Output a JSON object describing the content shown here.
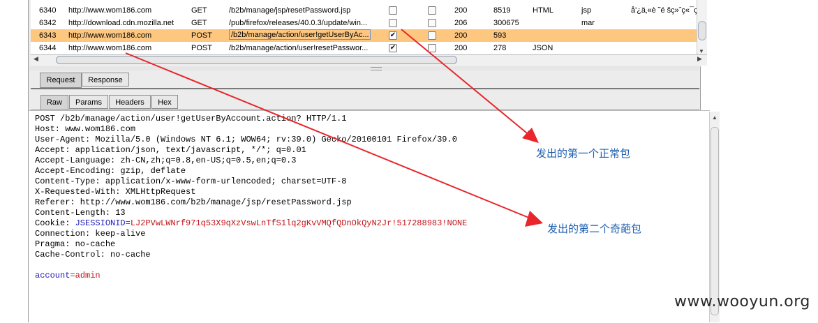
{
  "history": {
    "rows": [
      {
        "num": "6340",
        "host": "http://www.wom186.com",
        "method": "GET",
        "url": "/b2b/manage/jsp/resetPassword.jsp",
        "params": false,
        "edited": false,
        "status": "200",
        "length": "8519",
        "mime": "HTML",
        "ext": "jsp",
        "title": "å'¿ä‚«è ˜é šç»ˆç«¯ç©"
      },
      {
        "num": "6342",
        "host": "http://download.cdn.mozilla.net",
        "method": "GET",
        "url": "/pub/firefox/releases/40.0.3/update/win...",
        "params": false,
        "edited": false,
        "status": "206",
        "length": "300675",
        "mime": "",
        "ext": "mar",
        "title": ""
      },
      {
        "num": "6343",
        "host": "http://www.wom186.com",
        "method": "POST",
        "url": "/b2b/manage/action/user!getUserByAc...",
        "params": true,
        "edited": false,
        "status": "200",
        "length": "593",
        "mime": "",
        "ext": "",
        "title": ""
      },
      {
        "num": "6344",
        "host": "http://www.wom186.com",
        "method": "POST",
        "url": "/b2b/manage/action/user!resetPasswor...",
        "params": true,
        "edited": false,
        "status": "200",
        "length": "278",
        "mime": "JSON",
        "ext": "",
        "title": ""
      }
    ],
    "selected_index": 2
  },
  "tabs": {
    "outer": [
      "Request",
      "Response"
    ],
    "inner": [
      "Raw",
      "Params",
      "Headers",
      "Hex"
    ]
  },
  "request": {
    "lines": [
      "POST /b2b/manage/action/user!getUserByAccount.action? HTTP/1.1",
      "Host: www.wom186.com",
      "User-Agent: Mozilla/5.0 (Windows NT 6.1; WOW64; rv:39.0) Gecko/20100101 Firefox/39.0",
      "Accept: application/json, text/javascript, */*; q=0.01",
      "Accept-Language: zh-CN,zh;q=0.8,en-US;q=0.5,en;q=0.3",
      "Accept-Encoding: gzip, deflate",
      "Content-Type: application/x-www-form-urlencoded; charset=UTF-8",
      "X-Requested-With: XMLHttpRequest",
      "Referer: http://www.wom186.com/b2b/manage/jsp/resetPassword.jsp",
      "Content-Length: 13"
    ],
    "cookie_label": "Cookie: ",
    "cookie_name": "JSESSIONID",
    "cookie_value": "=LJ2PVwLWNrf971q53X9qXzVswLnTfS1lq2gKvVMQfQDnOkQyN2Jr!517288983!NONE",
    "lines_after": [
      "Connection: keep-alive",
      "Pragma: no-cache",
      "Cache-Control: no-cache"
    ],
    "body_key": "account",
    "body_value": "=admin"
  },
  "annotations": {
    "first": "发出的第一个正常包",
    "second": "发出的第二个奇葩包"
  },
  "watermark": "www.wooyun.org",
  "colors": {
    "selected_row": "#fdc780",
    "annotation": "#1f5fb0",
    "arrow": "#e8262b",
    "param_name": "#1a1ab8",
    "param_value": "#c0141a"
  }
}
